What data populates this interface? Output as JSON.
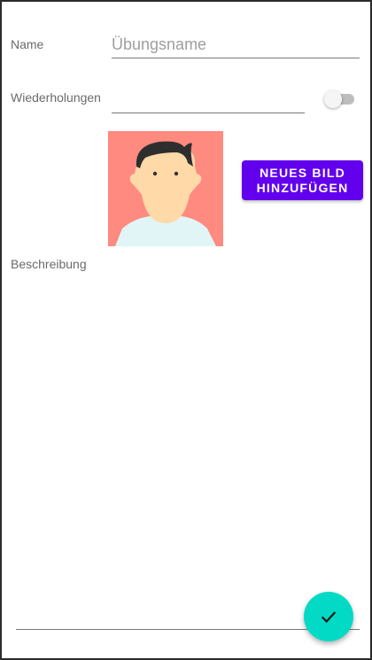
{
  "form": {
    "name_label": "Name",
    "name_placeholder": "Übungsname",
    "repetitions_label": "Wiederholungen",
    "repetitions_value": "",
    "repetitions_toggle": "off",
    "description_label": "Beschreibung",
    "description_value": ""
  },
  "image": {
    "icon": "avatar-placeholder",
    "background_color": "#ff8a80"
  },
  "actions": {
    "new_image_label": "NEUES BILD HINZUFÜGEN",
    "confirm_icon": "check-icon"
  },
  "colors": {
    "primary": "#6200ee",
    "secondary": "#03dac5"
  }
}
